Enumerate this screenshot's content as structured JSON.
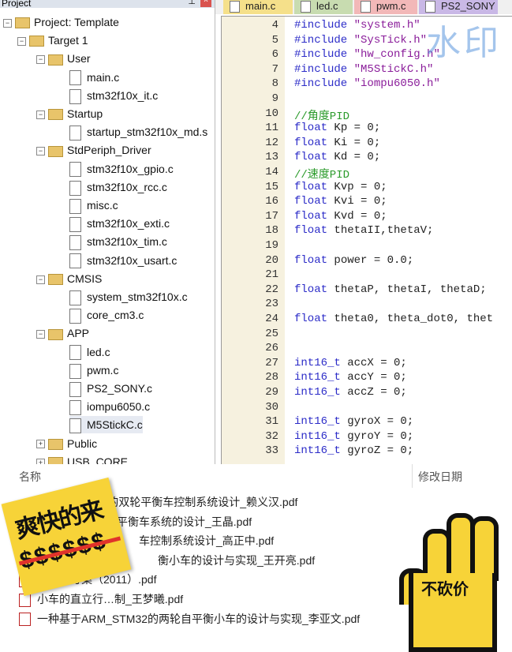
{
  "project_panel": {
    "title": "Project",
    "pin_icon": "pin-icon",
    "close_icon": "close-icon",
    "tree": [
      {
        "label": "Project: Template",
        "type": "project",
        "level": 0
      },
      {
        "label": "Target 1",
        "type": "target",
        "level": 1
      },
      {
        "label": "User",
        "type": "folder",
        "level": 2
      },
      {
        "label": "main.c",
        "type": "file",
        "level": 3
      },
      {
        "label": "stm32f10x_it.c",
        "type": "file",
        "level": 3
      },
      {
        "label": "Startup",
        "type": "folder",
        "level": 2
      },
      {
        "label": "startup_stm32f10x_md.s",
        "type": "file",
        "level": 3
      },
      {
        "label": "StdPeriph_Driver",
        "type": "folder",
        "level": 2
      },
      {
        "label": "stm32f10x_gpio.c",
        "type": "file",
        "level": 3
      },
      {
        "label": "stm32f10x_rcc.c",
        "type": "file",
        "level": 3
      },
      {
        "label": "misc.c",
        "type": "file",
        "level": 3
      },
      {
        "label": "stm32f10x_exti.c",
        "type": "file",
        "level": 3
      },
      {
        "label": "stm32f10x_tim.c",
        "type": "file",
        "level": 3
      },
      {
        "label": "stm32f10x_usart.c",
        "type": "file",
        "level": 3
      },
      {
        "label": "CMSIS",
        "type": "folder",
        "level": 2
      },
      {
        "label": "system_stm32f10x.c",
        "type": "file",
        "level": 3
      },
      {
        "label": "core_cm3.c",
        "type": "file",
        "level": 3
      },
      {
        "label": "APP",
        "type": "folder",
        "level": 2
      },
      {
        "label": "led.c",
        "type": "file",
        "level": 3
      },
      {
        "label": "pwm.c",
        "type": "file",
        "level": 3
      },
      {
        "label": "PS2_SONY.c",
        "type": "file",
        "level": 3
      },
      {
        "label": "iompu6050.c",
        "type": "file",
        "level": 3
      },
      {
        "label": "M5StickC.c",
        "type": "file",
        "level": 3,
        "selected": true
      },
      {
        "label": "Public",
        "type": "folder",
        "level": 2,
        "collapsed": true
      },
      {
        "label": "USB_CORE",
        "type": "folder",
        "level": 2,
        "collapsed": true
      }
    ]
  },
  "tabs": [
    {
      "label": "main.c",
      "color": "#f5e08a"
    },
    {
      "label": "led.c",
      "color": "#c8dcb0"
    },
    {
      "label": "pwm.c",
      "color": "#f2b8b8"
    },
    {
      "label": "PS2_SONY",
      "color": "#c9b8e6"
    }
  ],
  "watermark": "水印",
  "code": [
    {
      "n": "4",
      "t": "#include \"system.h\""
    },
    {
      "n": "5",
      "t": "#include \"SysTick.h\""
    },
    {
      "n": "6",
      "t": "#include \"hw_config.h\""
    },
    {
      "n": "7",
      "t": "#include \"M5StickC.h\""
    },
    {
      "n": "8",
      "t": "#include \"iompu6050.h\""
    },
    {
      "n": "9",
      "t": ""
    },
    {
      "n": "10",
      "t": "//角度PID"
    },
    {
      "n": "11",
      "t": "float Kp = 0;"
    },
    {
      "n": "12",
      "t": "float Ki = 0;"
    },
    {
      "n": "13",
      "t": "float Kd = 0;"
    },
    {
      "n": "14",
      "t": "//速度PID"
    },
    {
      "n": "15",
      "t": "float Kvp = 0;"
    },
    {
      "n": "16",
      "t": "float Kvi = 0;"
    },
    {
      "n": "17",
      "t": "float Kvd = 0;"
    },
    {
      "n": "18",
      "t": "float thetaII,thetaV;"
    },
    {
      "n": "19",
      "t": ""
    },
    {
      "n": "20",
      "t": "float power = 0.0;"
    },
    {
      "n": "21",
      "t": ""
    },
    {
      "n": "22",
      "t": "float thetaP, thetaI, thetaD;"
    },
    {
      "n": "23",
      "t": ""
    },
    {
      "n": "24",
      "t": "float theta0, theta_dot0, thet"
    },
    {
      "n": "25",
      "t": ""
    },
    {
      "n": "26",
      "t": ""
    },
    {
      "n": "27",
      "t": "int16_t accX = 0;"
    },
    {
      "n": "28",
      "t": "int16_t accY = 0;"
    },
    {
      "n": "29",
      "t": "int16_t accZ = 0;"
    },
    {
      "n": "30",
      "t": ""
    },
    {
      "n": "31",
      "t": "int16_t gyroX = 0;"
    },
    {
      "n": "32",
      "t": "int16_t gyroY = 0;"
    },
    {
      "n": "33",
      "t": "int16_t gyroZ = 0;"
    }
  ],
  "file_list": {
    "col_name": "名称",
    "col_date": "修改日期",
    "rows": [
      "MPU6050的双轮平衡车控制系统设计_赖义汉.pdf",
      "平衡车系统的设计_王晶.pdf",
      "车控制系统设计_高正中.pdf",
      "衡小车的设计与实现_王开亮.pdf",
      "清…计方案（2011）.pdf",
      "小车的直立行…制_王梦曦.pdf",
      "一种基于ARM_STM32的两轮自平衡小车的设计与实现_李亚文.pdf"
    ]
  },
  "sticker_left": {
    "text": "爽快的来",
    "dollars": "$$$$$$"
  },
  "sticker_right": {
    "text": "不砍价"
  }
}
